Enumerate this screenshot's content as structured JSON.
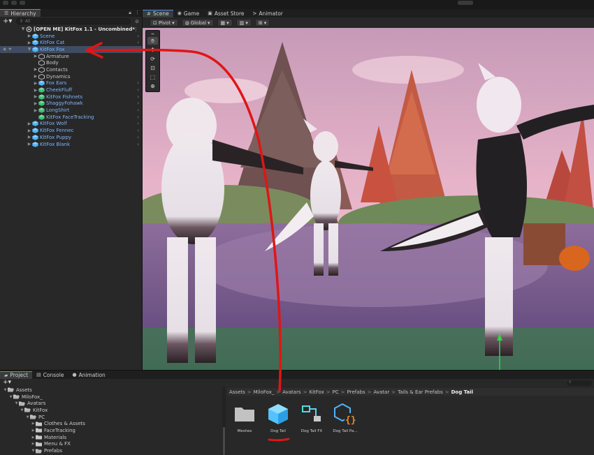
{
  "hierarchy": {
    "tab_label": "Hierarchy",
    "search_placeholder": "All",
    "items": [
      {
        "label": "[OPEN ME] KitFox 1.1 - Uncombined*",
        "depth": 0,
        "kind": "root"
      },
      {
        "label": "Scene",
        "depth": 1,
        "kind": "prefab"
      },
      {
        "label": "KitFox Cat",
        "depth": 1,
        "kind": "prefab"
      },
      {
        "label": "KitFox Fox",
        "depth": 1,
        "kind": "prefab",
        "selected": true,
        "expanded": true
      },
      {
        "label": "Armature",
        "depth": 2,
        "kind": "object"
      },
      {
        "label": "Body",
        "depth": 2,
        "kind": "object"
      },
      {
        "label": "Contacts",
        "depth": 2,
        "kind": "object"
      },
      {
        "label": "Dynamics",
        "depth": 2,
        "kind": "object"
      },
      {
        "label": "Fox Ears",
        "depth": 2,
        "kind": "prefab"
      },
      {
        "label": "CheekFluff",
        "depth": 2,
        "kind": "prefab-green"
      },
      {
        "label": "KitFox Fishnets",
        "depth": 2,
        "kind": "prefab-green"
      },
      {
        "label": "ShaggyFohawk",
        "depth": 2,
        "kind": "prefab-green"
      },
      {
        "label": "LongShirt",
        "depth": 2,
        "kind": "prefab-green"
      },
      {
        "label": "KitFox FaceTracking",
        "depth": 2,
        "kind": "prefab-green"
      },
      {
        "label": "KitFox Wolf",
        "depth": 1,
        "kind": "prefab"
      },
      {
        "label": "KitFox Fennec",
        "depth": 1,
        "kind": "prefab"
      },
      {
        "label": "KitFox Puppy",
        "depth": 1,
        "kind": "prefab"
      },
      {
        "label": "KitFox Blank",
        "depth": 1,
        "kind": "prefab"
      }
    ]
  },
  "scene": {
    "tabs": [
      "Scene",
      "Game",
      "Asset Store",
      "Animator"
    ],
    "toolbar": {
      "pivot": "Pivot",
      "global": "Global"
    }
  },
  "project": {
    "tabs": [
      "Project",
      "Console",
      "Animation"
    ],
    "search_placeholder": "",
    "folders": [
      {
        "label": "Assets",
        "depth": 0
      },
      {
        "label": "MiloFox_",
        "depth": 1
      },
      {
        "label": "Avatars",
        "depth": 2
      },
      {
        "label": "KitFox",
        "depth": 3
      },
      {
        "label": "PC",
        "depth": 4
      },
      {
        "label": "Clothes & Assets",
        "depth": 5
      },
      {
        "label": "FaceTracking",
        "depth": 5
      },
      {
        "label": "Materials",
        "depth": 5
      },
      {
        "label": "Menu & FX",
        "depth": 5
      },
      {
        "label": "Prefabs",
        "depth": 5
      }
    ],
    "breadcrumb": [
      "Assets",
      "MiloFox_",
      "Avatars",
      "KitFox",
      "PC",
      "Prefabs",
      "Avatar",
      "Tails & Ear Prefabs",
      "Dog Tail"
    ],
    "assets": [
      {
        "name": "Meshes",
        "icon": "folder-icon"
      },
      {
        "name": "Dog Tail",
        "icon": "prefab-icon"
      },
      {
        "name": "Dog Tail FX",
        "icon": "animator-controller-icon"
      },
      {
        "name": "Dog Tail Pa...",
        "icon": "parameters-icon"
      }
    ]
  },
  "colors": {
    "accent_blue": "#4a8ef0",
    "prefab_blue": "#4fb4ff",
    "selection": "#3e4d64",
    "annotation_red": "#e01515"
  }
}
